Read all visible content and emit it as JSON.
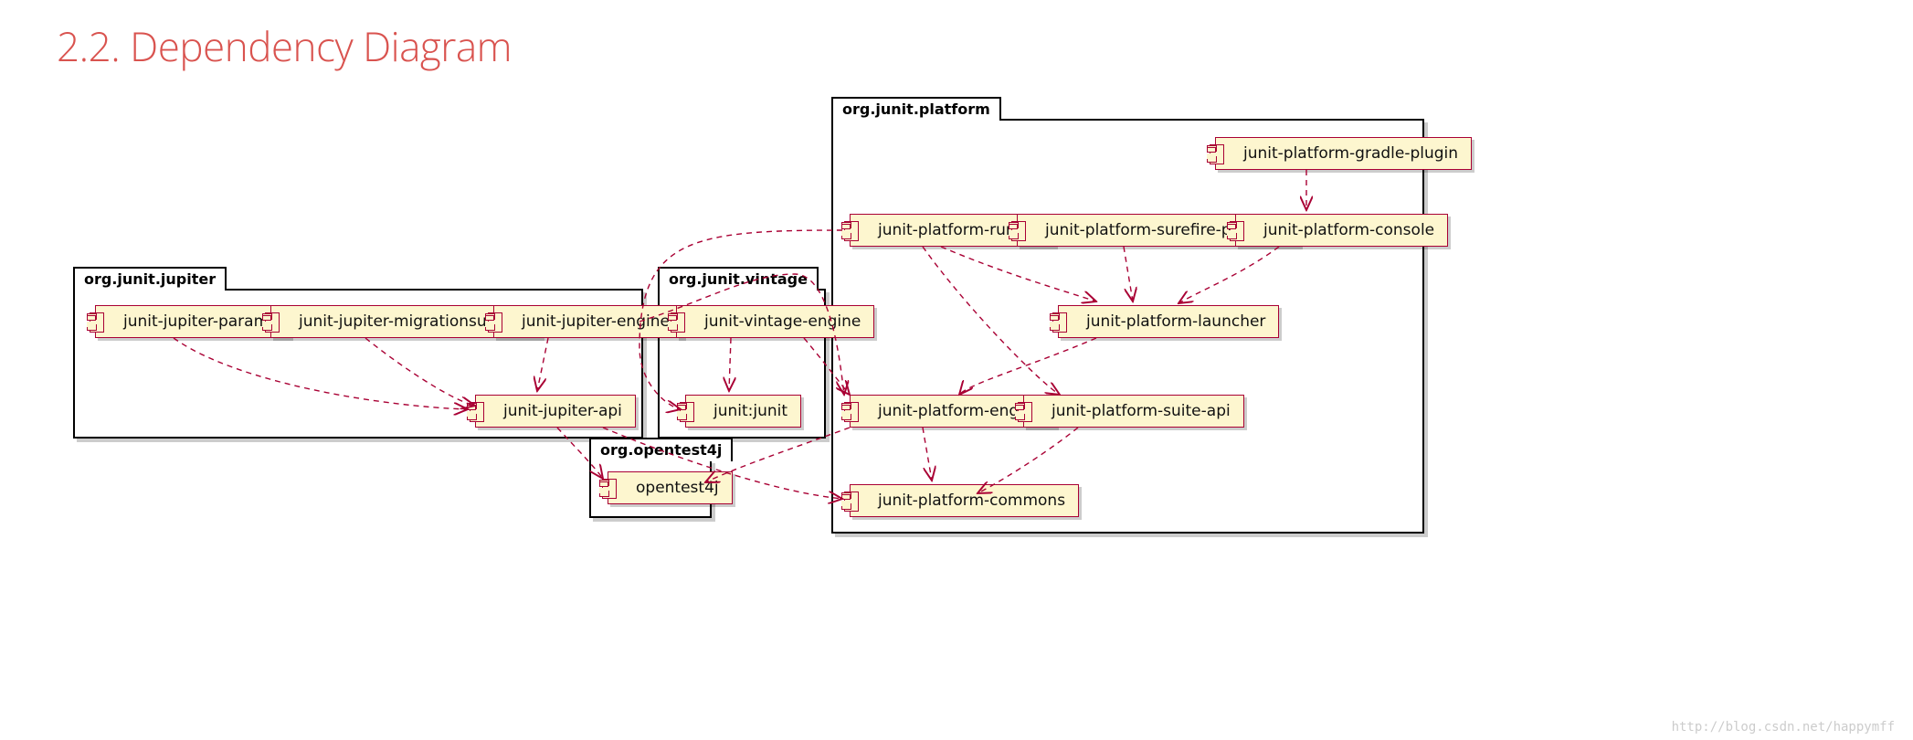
{
  "heading": "2.2. Dependency Diagram",
  "packages": {
    "jupiter": {
      "label": "org.junit.jupiter"
    },
    "vintage": {
      "label": "org.junit.vintage"
    },
    "opentest4j": {
      "label": "org.opentest4j"
    },
    "platform": {
      "label": "org.junit.platform"
    }
  },
  "components": {
    "jupiter_params": "junit-jupiter-params",
    "jupiter_migration": "junit-jupiter-migrationsupport",
    "jupiter_engine": "junit-jupiter-engine",
    "jupiter_api": "junit-jupiter-api",
    "vintage_engine": "junit-vintage-engine",
    "junit4": "junit:junit",
    "opentest4j": "opentest4j",
    "plat_gradle": "junit-platform-gradle-plugin",
    "plat_runner": "junit-platform-runner",
    "plat_surefire": "junit-platform-surefire-provider",
    "plat_console": "junit-platform-console",
    "plat_launcher": "junit-platform-launcher",
    "plat_engine": "junit-platform-engine",
    "plat_suite_api": "junit-platform-suite-api",
    "plat_commons": "junit-platform-commons"
  },
  "dependencies": [
    [
      "jupiter_params",
      "jupiter_api"
    ],
    [
      "jupiter_migration",
      "jupiter_api"
    ],
    [
      "jupiter_engine",
      "jupiter_api"
    ],
    [
      "jupiter_engine",
      "plat_engine"
    ],
    [
      "jupiter_api",
      "opentest4j"
    ],
    [
      "jupiter_api",
      "plat_commons"
    ],
    [
      "vintage_engine",
      "junit4"
    ],
    [
      "vintage_engine",
      "plat_engine"
    ],
    [
      "plat_gradle",
      "plat_console"
    ],
    [
      "plat_runner",
      "plat_launcher"
    ],
    [
      "plat_runner",
      "plat_suite_api"
    ],
    [
      "plat_surefire",
      "plat_launcher"
    ],
    [
      "plat_console",
      "plat_launcher"
    ],
    [
      "plat_launcher",
      "plat_engine"
    ],
    [
      "plat_engine",
      "opentest4j"
    ],
    [
      "plat_engine",
      "plat_commons"
    ],
    [
      "plat_suite_api",
      "plat_commons"
    ],
    [
      "plat_runner",
      "junit4"
    ]
  ],
  "watermark": "http://blog.csdn.net/happymff"
}
